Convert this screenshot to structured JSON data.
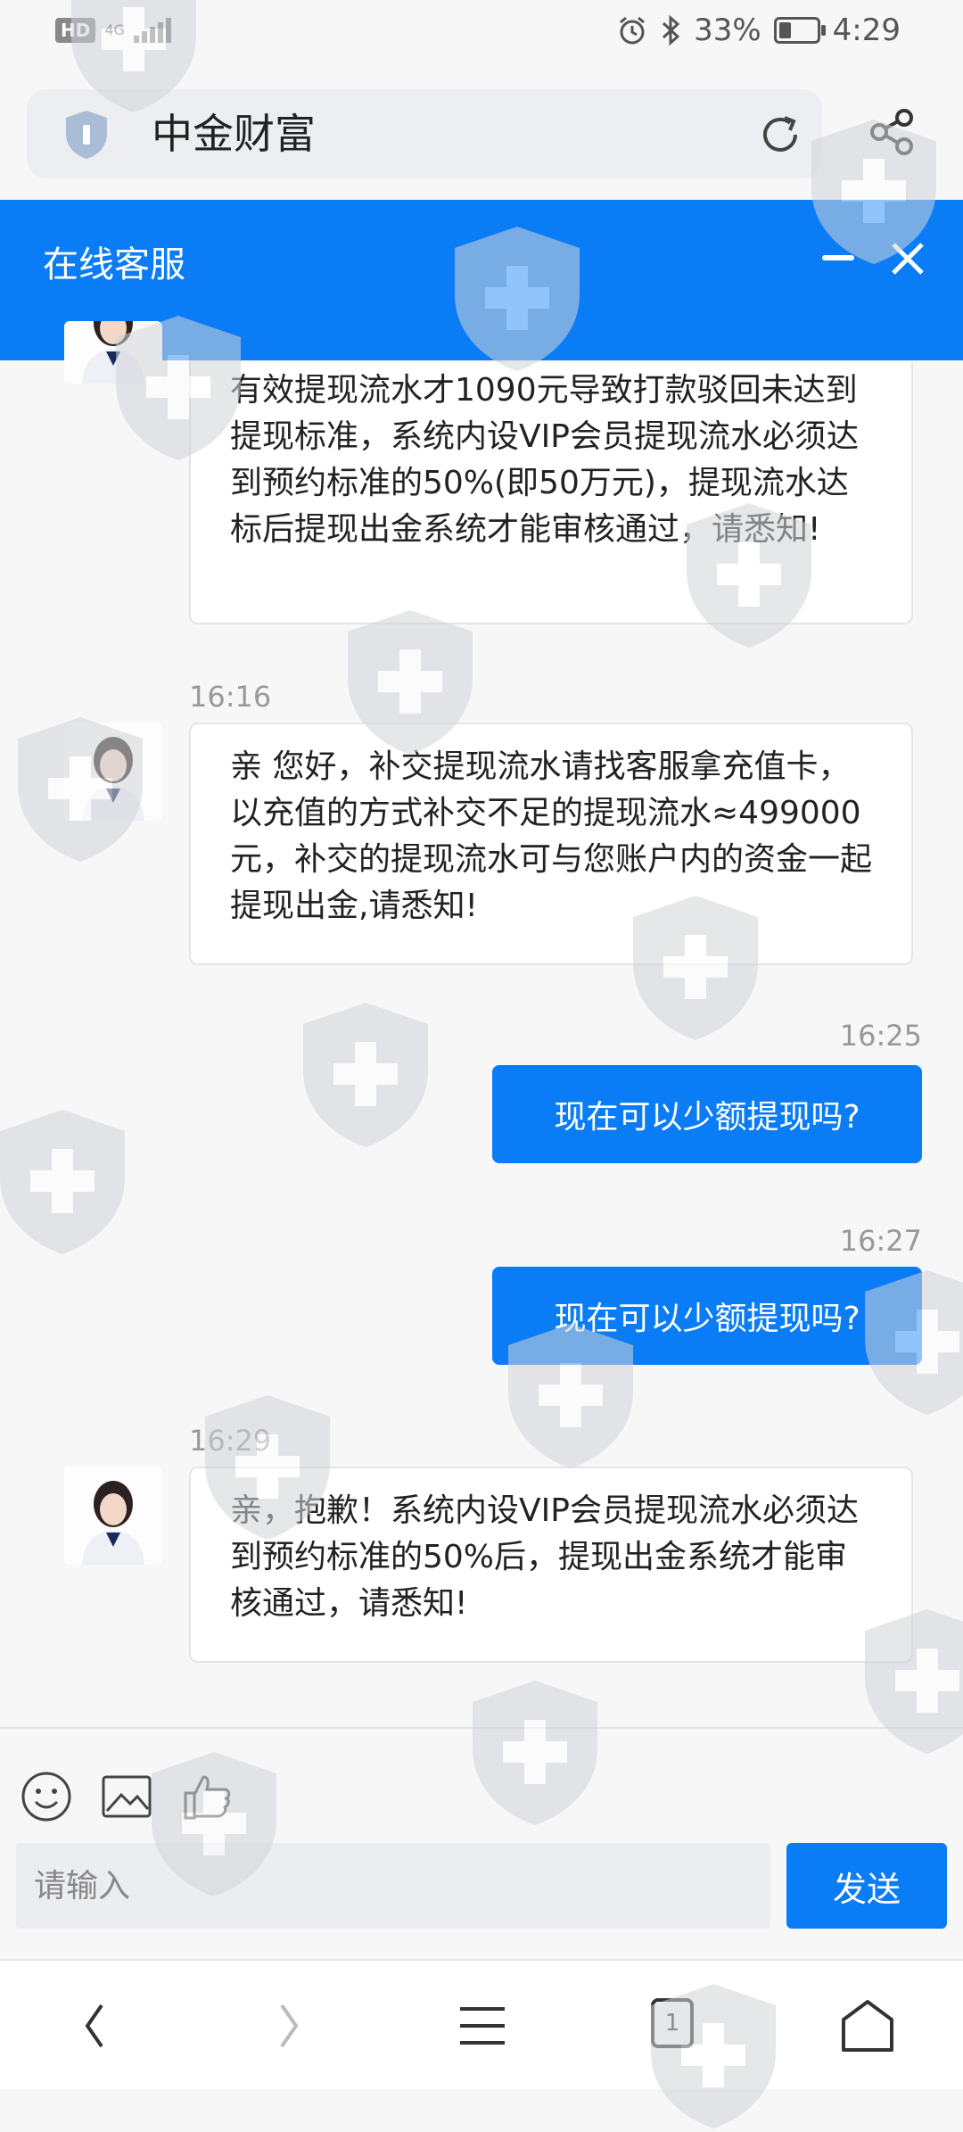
{
  "status_bar": {
    "hd": "HD",
    "network": "4G",
    "battery_percent": "33%",
    "battery_level": 0.33,
    "time": "4:29"
  },
  "browser": {
    "site_title": "中金财富"
  },
  "chat": {
    "title": "在线客服",
    "messages": [
      {
        "from": "agent",
        "time": "",
        "text": "有效提现流水才1090元导致打款驳回未达到提现标准，系统内设VIP会员提现流水必须达到预约标准的50%(即50万元)，提现流水达标后提现出金系统才能审核通过，请悉知!"
      },
      {
        "from": "agent",
        "time": "16:16",
        "text": "亲 您好，补交提现流水请找客服拿充值卡，以充值的方式补交不足的提现流水≈499000元，补交的提现流水可与您账户内的资金一起提现出金,请悉知!"
      },
      {
        "from": "user",
        "time": "16:25",
        "text": "现在可以少额提现吗?"
      },
      {
        "from": "user",
        "time": "16:27",
        "text": "现在可以少额提现吗?"
      },
      {
        "from": "agent",
        "time": "16:29",
        "text": "亲，抱歉！系统内设VIP会员提现流水必须达到预约标准的50%后，提现出金系统才能审核通过，请悉知!"
      }
    ]
  },
  "composer": {
    "placeholder": "请输入",
    "send_label": "发送"
  },
  "nav": {
    "tab_count": "1"
  },
  "colors": {
    "accent": "#0a7cf5",
    "background": "#f7f7f8"
  }
}
